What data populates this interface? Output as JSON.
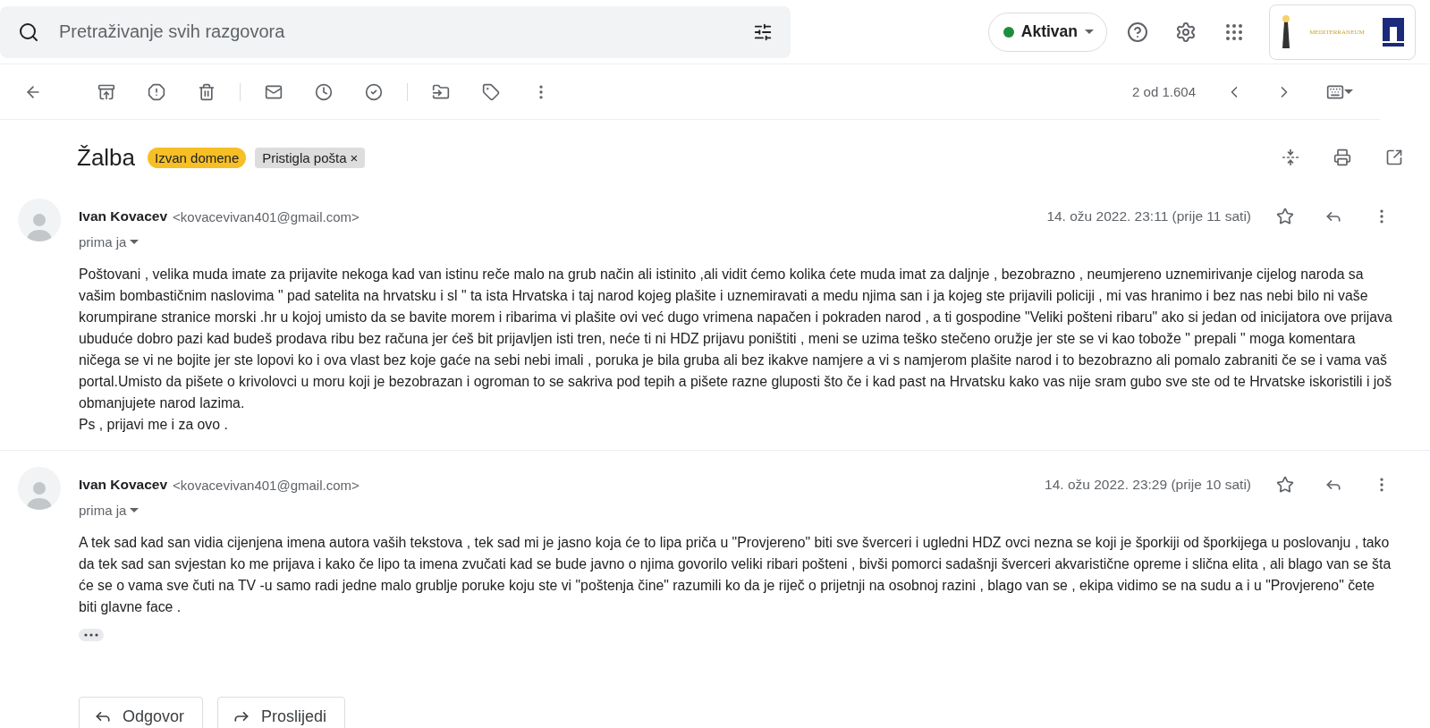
{
  "search": {
    "placeholder": "Pretraživanje svih razgovora"
  },
  "status": {
    "label": "Aktivan",
    "color": "#1e8e3e"
  },
  "logo": {
    "text": "MEDITERRANEUM"
  },
  "pager": {
    "text": "2 od 1.604"
  },
  "subject": "Žalba",
  "labels": [
    {
      "text": "Izvan domene",
      "kind": "tag",
      "color": "#f6bf26"
    },
    {
      "text": "Pristigla pošta",
      "kind": "removable",
      "remove": "×",
      "color": "#dddddd"
    }
  ],
  "messages": [
    {
      "sender": "Ivan Kovacev",
      "email": "<kovacevivan401@gmail.com>",
      "recipients": "prima ja",
      "date": "14. ožu 2022. 23:11 (prije 11 sati)",
      "starred": false,
      "body": [
        "Poštovani , velika muda imate za prijavite nekoga kad van istinu reče  malo na grub način ali istinito ,ali vidit ćemo kolika ćete muda imat za daljnje , bezobrazno , neumjereno uznemirivanje cijelog naroda sa vašim bombastičnim naslovima \" pad satelita na hrvatsku i sl \" ta ista Hrvatska i taj narod kojeg plašite i uznemiravati a medu njima san i ja kojeg ste prijavili policiji , mi vas hranimo i bez nas nebi bilo ni vaše korumpirane stranice morski .hr u kojoj umisto da se bavite morem i ribarima vi plašite ovi već dugo vrimena napačen i pokraden narod , a ti gospodine \"Veliki pošteni ribaru\"  ako si jedan od inicijatora ove prijava ubuduće dobro pazi kad budeš prodava ribu bez računa jer ćeš bit prijavljen isti tren, neće ti ni HDZ prijavu poništiti  , meni se uzima teško stečeno oružje jer ste se vi kao tobože \" prepali \" moga komentara ničega se vi ne bojite jer ste lopovi ko i ova vlast bez koje gaće na sebi nebi imali , poruka je bila gruba ali bez ikakve namjere a vi s namjerom plašite narod i to bezobrazno ali pomalo zabraniti če se i vama vaš portal.Umisto da pišete o krivolovci u moru koji je bezobrazan i ogroman to se sakriva pod tepih a pišete razne gluposti što če i kad past na Hrvatsku kako vas nije sram gubo sve ste od te Hrvatske iskoristili i još obmanjujete narod lazima.",
        "Ps , prijavi me i za ovo ."
      ]
    },
    {
      "sender": "Ivan Kovacev",
      "email": "<kovacevivan401@gmail.com>",
      "recipients": "prima ja",
      "date": "14. ožu 2022. 23:29 (prije 10 sati)",
      "starred": false,
      "trimmed": true,
      "body": [
        "A tek sad kad san vidia cijenjena imena autora vaših tekstova , tek sad mi je jasno koja će to lipa priča u \"Provjereno\" biti sve šverceri i ugledni HDZ ovci nezna se koji je šporkiji od šporkijega u poslovanju , tako da tek sad san svjestan ko me prijava i kako če lipo ta imena zvučati kad se bude javno o njima govorilo veliki ribari pošteni , bivši pomorci sadašnji šverceri akvaristične opreme i slična elita , ali blago van se šta će se o vama sve čuti na TV -u samo radi jedne malo grublje poruke koju ste vi \"poštenja čine\" razumili ko da je riječ o prijetnji na osobnoj razini , blago van se , ekipa vidimo se na sudu a i u \"Provjereno\" čete biti glavne face ."
      ]
    }
  ],
  "actions": [
    {
      "label": "Odgovor",
      "kind": "reply"
    },
    {
      "label": "Proslijedi",
      "kind": "forward"
    }
  ]
}
